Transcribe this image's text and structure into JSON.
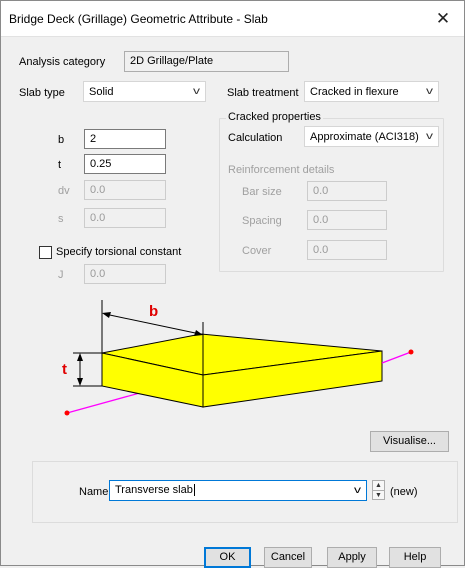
{
  "window": {
    "title": "Bridge Deck (Grillage) Geometric Attribute - Slab",
    "close_glyph": "✕"
  },
  "analysis_category": {
    "label": "Analysis category",
    "value": "2D Grillage/Plate"
  },
  "slab_type": {
    "label": "Slab type",
    "value": "Solid"
  },
  "slab_treatment": {
    "label": "Slab treatment",
    "value": "Cracked in flexure"
  },
  "cracked": {
    "title": "Cracked properties",
    "calculation_label": "Calculation",
    "calculation_value": "Approximate (ACI318)",
    "reinforcement": {
      "title": "Reinforcement details",
      "bar_size_label": "Bar size",
      "bar_size_value": "0.0",
      "spacing_label": "Spacing",
      "spacing_value": "0.0",
      "cover_label": "Cover",
      "cover_value": "0.0"
    }
  },
  "fields": {
    "b_label": "b",
    "b_value": "2",
    "t_label": "t",
    "t_value": "0.25",
    "dv_label": "dv",
    "dv_value": "0.0",
    "s_label": "s",
    "s_value": "0.0",
    "j_label": "J",
    "j_value": "0.0"
  },
  "torsional": {
    "label": "Specify torsional constant",
    "checked": false
  },
  "diagram": {
    "b_label": "b",
    "t_label": "t",
    "slab_color": "#ffff00",
    "axis_color": "#ff00ff",
    "label_color": "#e00000"
  },
  "visualise_button": "Visualise...",
  "name": {
    "label": "Name",
    "value": "Transverse slab",
    "suffix": "(new)"
  },
  "buttons": {
    "ok": "OK",
    "cancel": "Cancel",
    "apply": "Apply",
    "help": "Help"
  }
}
